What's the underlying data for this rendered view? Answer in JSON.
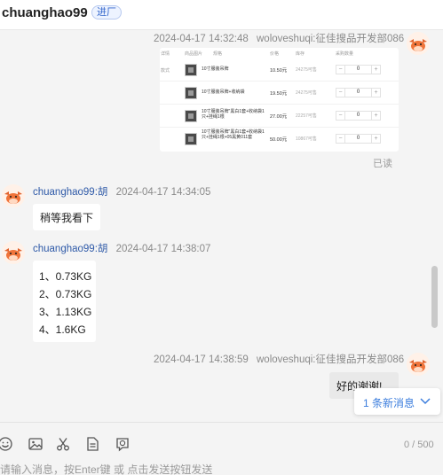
{
  "header": {
    "title": "chuanghao99",
    "badge": "进厂"
  },
  "messages": [
    {
      "type": "outgoing-product",
      "timestamp": "2024-04-17 14:32:48",
      "sender": "woloveshuqi:征佳搜品开发部086",
      "card": {
        "columns": [
          "详情",
          "商品图片",
          "规格",
          "价格",
          "库存",
          "采购数量"
        ],
        "side_label": "款式",
        "rows": [
          {
            "name": "10寸服装吊牌",
            "price": "10.50元",
            "stock": "24275可售",
            "qty": "0"
          },
          {
            "name": "10寸服装吊牌+收纳袋",
            "price": "19.50元",
            "stock": "24275可售",
            "qty": "0"
          },
          {
            "name": "10寸服装吊牌\"黑白1套+收纳袋1只+挂绳1根",
            "price": "27.00元",
            "stock": "22257可售",
            "qty": "0"
          },
          {
            "name": "10寸服装吊牌\"黑白1套+收纳袋1只+挂绳1根+05黑黄011套",
            "price": "50.00元",
            "stock": "10867可售",
            "qty": "0"
          }
        ]
      },
      "status": "已读"
    },
    {
      "type": "incoming",
      "nick": "chuanghao99:胡",
      "timestamp": "2024-04-17 14:34:05",
      "lines": [
        "稍等我看下"
      ]
    },
    {
      "type": "incoming",
      "nick": "chuanghao99:胡",
      "timestamp": "2024-04-17 14:38:07",
      "lines": [
        "1、0.73KG",
        "2、0.73KG",
        "3、1.13KG",
        "4、1.6KG"
      ]
    },
    {
      "type": "outgoing",
      "timestamp": "2024-04-17 14:38:59",
      "sender": "woloveshuqi:征佳搜品开发部086",
      "lines": [
        "好的谢谢!"
      ]
    }
  ],
  "new_messages_label": "1 条新消息",
  "composer": {
    "counter": "0 / 500",
    "placeholder": "请输入消息，按Enter键 或 点击发送按钮发送",
    "tools": [
      "emoji-icon",
      "image-icon",
      "scissors-icon",
      "file-icon",
      "history-icon"
    ]
  },
  "colors": {
    "accent": "#3b7ddd",
    "nick": "#2f5aa8",
    "badge_text": "#3366cc"
  }
}
